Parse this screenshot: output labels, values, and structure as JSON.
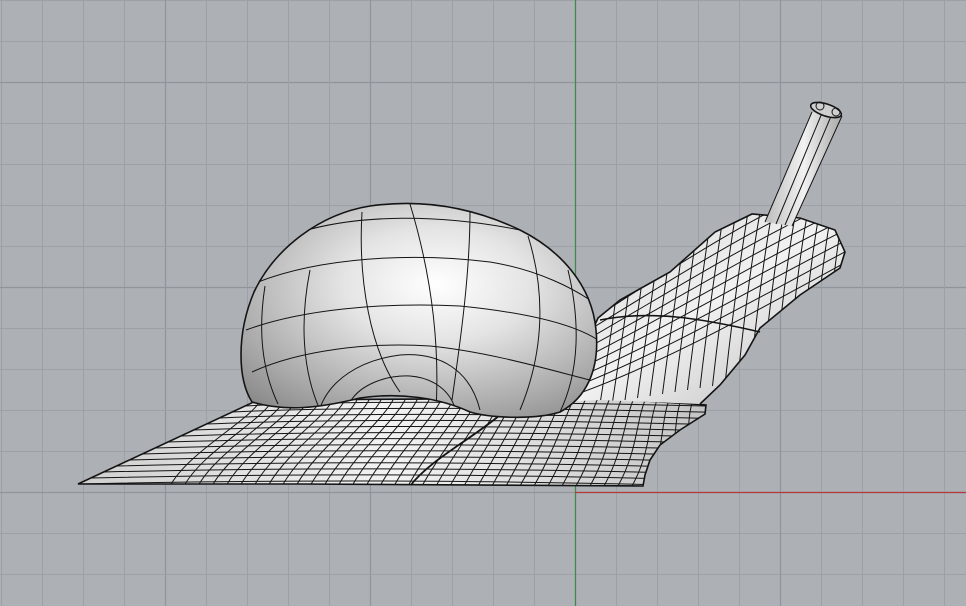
{
  "viewport": {
    "view": "Front",
    "display_mode": "shaded-with-isocurves",
    "colors": {
      "background": "#adb1b6",
      "grid_minor": "#9ca1a7",
      "grid_major": "#8f959c",
      "axis_x": "#b13b3b",
      "axis_y": "#3c8a4c",
      "wire": "#141414",
      "surface_light": "#f4f4f4",
      "surface_mid": "#c9c9c9",
      "surface_dark": "#8a8a8a"
    }
  },
  "model": {
    "object_name": "snail",
    "parts": [
      "foot",
      "neck",
      "head",
      "tentacle",
      "shell"
    ]
  }
}
